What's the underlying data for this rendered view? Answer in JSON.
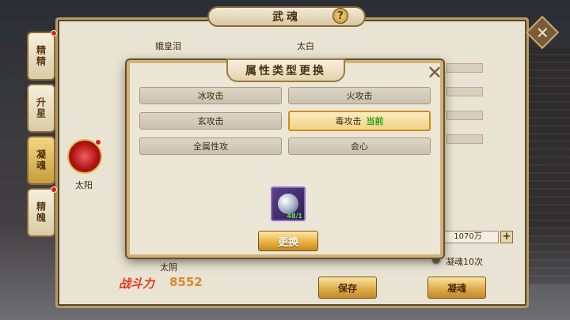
{
  "window": {
    "title": "武魂",
    "help_glyph": "?"
  },
  "side_tabs": [
    {
      "label": "精精",
      "has_dot": true
    },
    {
      "label": "升星",
      "has_dot": false
    },
    {
      "label": "凝魂",
      "has_dot": false,
      "active": true
    },
    {
      "label": "精魄",
      "has_dot": true
    }
  ],
  "main": {
    "top_name": "娥皇泪",
    "top_right_name": "太白",
    "left_orb_label": "太阳",
    "bottom_orb_label": "太阴",
    "power_label": "战斗力",
    "power_value": "8552",
    "amount": "1070万",
    "plus": "+",
    "radio_label": "凝魂10次",
    "save_button": "保存",
    "condense_button": "凝魂"
  },
  "modal": {
    "title": "属性类型更换",
    "close_glyph": "✕",
    "options": [
      {
        "label": "冰攻击"
      },
      {
        "label": "火攻击"
      },
      {
        "label": "玄攻击"
      },
      {
        "label": "毒攻击",
        "current": "当前"
      },
      {
        "label": "全属性攻"
      },
      {
        "label": "会心"
      }
    ],
    "item": {
      "icon": "soul-stone-icon",
      "count": "48/1"
    },
    "swap_button": "更换"
  },
  "colors": {
    "accent_gold": "#dca847",
    "selected_border": "#c98f1f",
    "current_green": "#2d9e1c",
    "power_red": "#e03a1c"
  }
}
